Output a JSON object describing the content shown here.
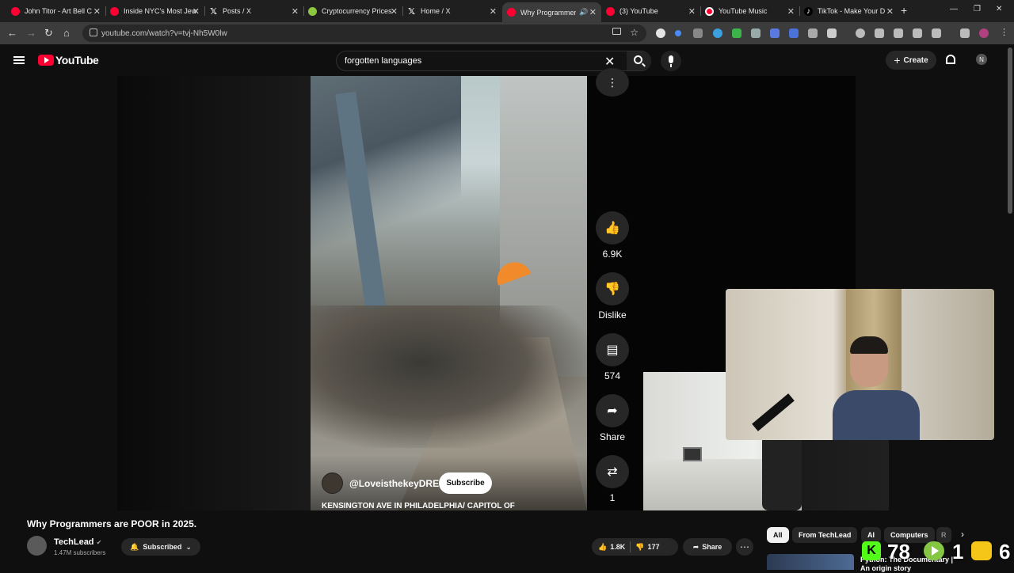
{
  "browser": {
    "tabs": [
      {
        "title": "John Titor - Art Bell C",
        "icon": "youtube-icon"
      },
      {
        "title": "Inside NYC's Most Jew",
        "icon": "youtube-icon"
      },
      {
        "title": "Posts / X",
        "icon": "x-icon"
      },
      {
        "title": "Cryptocurrency Prices",
        "icon": "coinmarket-icon"
      },
      {
        "title": "Home / X",
        "icon": "x-icon"
      },
      {
        "title": "Why Programmers",
        "icon": "youtube-icon"
      },
      {
        "title": "(3) YouTube",
        "icon": "youtube-icon"
      },
      {
        "title": "YouTube Music",
        "icon": "youtube-music-icon"
      },
      {
        "title": "TikTok - Make Your D",
        "icon": "tiktok-icon"
      }
    ],
    "url": "youtube.com/watch?v=tvj-Nh5W0lw"
  },
  "youtube": {
    "logo_text": "YouTube",
    "search_value": "forgotten languages",
    "create_label": "Create",
    "avatar_letter": "N"
  },
  "short": {
    "channel": "@LoveisthekeyDRE",
    "subscribe_label": "Subscribe",
    "caption": "KENSINGTON AVE IN PHILADELPHIA/ CAPITOL OF",
    "likes": "6.9K",
    "dislike_label": "Dislike",
    "comments": "574",
    "share_label": "Share",
    "remix_count": "1"
  },
  "video": {
    "title": "Why Programmers are POOR in 2025.",
    "channel": "TechLead",
    "subscribers": "1.47M subscribers",
    "subscribed_label": "Subscribed",
    "likes": "1.8K",
    "dislikes": "177",
    "share_label": "Share"
  },
  "chips": [
    "All",
    "From TechLead",
    "AI",
    "Computers",
    "R"
  ],
  "related": {
    "title": "Python: The Documentary | An origin story"
  },
  "overlay": {
    "kick_count": "78",
    "rumble_count": "1",
    "third_count": "6"
  }
}
